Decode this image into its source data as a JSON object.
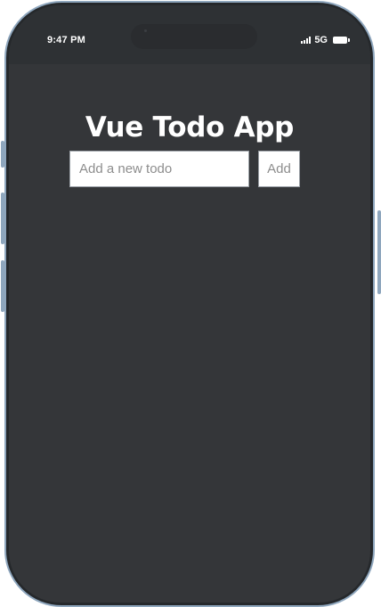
{
  "status_bar": {
    "time": "9:47 PM",
    "network": "5G",
    "icons": [
      "signal-icon",
      "battery-icon"
    ]
  },
  "app": {
    "title": "Vue Todo App",
    "input": {
      "placeholder": "Add a new todo",
      "value": ""
    },
    "add_button_label": "Add"
  },
  "colors": {
    "screen_background": "#343639",
    "status_bar_background": "#2e3134",
    "title_color": "#ffffff",
    "frame_color": "#8ea6bd"
  }
}
